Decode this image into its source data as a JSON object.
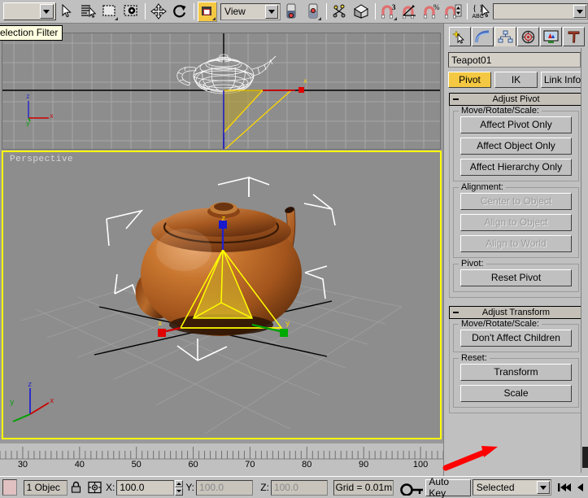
{
  "app": {
    "title": "3ds Max - Hierarchy / Pivot",
    "accent_yellow": "#f4c842",
    "viewport_bg": "#8d8d8d",
    "panel_bg": "#c0c0c0",
    "teapot_color": "#b35a19",
    "annotation_color": "#ff0000"
  },
  "tooltip": {
    "text": "election Filter"
  },
  "toolbar": {
    "selection_filter": {
      "value": "",
      "name": "selection-filter-combo"
    },
    "buttons": [
      {
        "name": "select-object-button",
        "icon": "arrow-cursor-icon",
        "label": "Select Object",
        "active": false
      },
      {
        "name": "select-by-name-button",
        "icon": "list-cursor-icon",
        "label": "Select by Name",
        "active": false
      },
      {
        "name": "rectangular-selection-region-button",
        "icon": "rect-marquee-icon",
        "label": "Rectangular Selection Region",
        "active": false
      },
      {
        "name": "window-crossing-button",
        "icon": "window-crossing-icon",
        "label": "Window / Crossing",
        "active": false
      },
      {
        "name": "select-and-move-button",
        "icon": "move-cross-icon",
        "label": "Select and Move",
        "active": false
      },
      {
        "name": "select-and-rotate-button",
        "icon": "rotate-arrow-icon",
        "label": "Select and Rotate",
        "active": false
      },
      {
        "name": "select-and-uniform-scale-button",
        "icon": "scale-box-icon",
        "label": "Select and Uniform Scale",
        "active": true
      }
    ],
    "reference_coordinate_system": {
      "value": "View",
      "name": "reference-coordinate-system-combo"
    },
    "pivot_buttons": [
      {
        "name": "use-pivot-point-center-button",
        "icon": "pivot-center-icon",
        "label": "Use Pivot Point Center"
      },
      {
        "name": "use-selection-center-button",
        "icon": "selection-center-icon",
        "label": "Use Selection Center"
      }
    ],
    "right_buttons": [
      {
        "name": "select-and-link-button",
        "icon": "link-chain-icon",
        "label": "Select and Link"
      },
      {
        "name": "mirror-button",
        "icon": "mirror-box-icon",
        "label": "Mirror"
      },
      {
        "name": "snaps-toggle-button",
        "icon": "magnet-3-icon",
        "label": "Snaps Toggle",
        "badge": "3"
      },
      {
        "name": "angle-snap-toggle-button",
        "icon": "magnet-angle-icon",
        "label": "Angle Snap Toggle"
      },
      {
        "name": "percent-snap-toggle-button",
        "icon": "magnet-percent-icon",
        "label": "Percent Snap Toggle",
        "badge": "%"
      },
      {
        "name": "spinner-snap-toggle-button",
        "icon": "magnet-spinner-icon",
        "label": "Spinner Snap Toggle"
      },
      {
        "name": "named-selection-sets-button",
        "icon": "named-selection-icon",
        "label": "Named Selection Sets"
      }
    ],
    "named_selection_field": {
      "value": "",
      "name": "named-selection-field"
    }
  },
  "viewports": [
    {
      "name": "viewport-front",
      "label": "",
      "active": false,
      "shading": "wireframe",
      "object": "teapot-wireframe"
    },
    {
      "name": "viewport-perspective",
      "label": "Perspective",
      "active": true,
      "shading": "smooth-highlights",
      "object": "teapot-shaded"
    }
  ],
  "axis_tripod": {
    "x": "x",
    "y": "y",
    "z": "z",
    "x_color": "#cc0000",
    "y_color": "#00a000",
    "z_color": "#2222cc"
  },
  "command_panel": {
    "tabs": [
      {
        "name": "tab-create",
        "icon": "star-arrow-icon",
        "label": "Create",
        "selected": false
      },
      {
        "name": "tab-modify",
        "icon": "curve-bend-icon",
        "label": "Modify",
        "selected": false
      },
      {
        "name": "tab-hierarchy",
        "icon": "hierarchy-tree-icon",
        "label": "Hierarchy",
        "selected": true
      },
      {
        "name": "tab-motion",
        "icon": "motion-wheel-icon",
        "label": "Motion",
        "selected": false
      },
      {
        "name": "tab-display",
        "icon": "display-monitor-icon",
        "label": "Display",
        "selected": false
      },
      {
        "name": "tab-utilities",
        "icon": "hammer-icon",
        "label": "Utilities",
        "selected": false
      }
    ],
    "object_name": {
      "value": "Teapot01",
      "placeholder": ""
    },
    "object_color": "#b8561a",
    "mode_buttons": [
      {
        "name": "pivot-mode-button",
        "label": "Pivot",
        "active": true
      },
      {
        "name": "ik-mode-button",
        "label": "IK",
        "active": false
      },
      {
        "name": "link-info-mode-button",
        "label": "Link Info",
        "active": false
      }
    ],
    "rollouts": [
      {
        "name": "rollout-adjust-pivot",
        "title": "Adjust Pivot",
        "expanded": true,
        "groups": [
          {
            "name": "group-move-rotate-scale",
            "label": "Move/Rotate/Scale:",
            "buttons": [
              {
                "name": "affect-pivot-only-button",
                "label": "Affect Pivot Only",
                "disabled": false
              },
              {
                "name": "affect-object-only-button",
                "label": "Affect Object Only",
                "disabled": false
              },
              {
                "name": "affect-hierarchy-only-button",
                "label": "Affect Hierarchy Only",
                "disabled": false
              }
            ]
          },
          {
            "name": "group-alignment",
            "label": "Alignment:",
            "buttons": [
              {
                "name": "center-to-object-button",
                "label": "Center to Object",
                "disabled": true
              },
              {
                "name": "align-to-object-button",
                "label": "Align to Object",
                "disabled": true
              },
              {
                "name": "align-to-world-button",
                "label": "Align to World",
                "disabled": true
              }
            ]
          },
          {
            "name": "group-pivot",
            "label": "Pivot:",
            "buttons": [
              {
                "name": "reset-pivot-button",
                "label": "Reset Pivot",
                "disabled": false
              }
            ]
          }
        ]
      },
      {
        "name": "rollout-adjust-transform",
        "title": "Adjust Transform",
        "expanded": true,
        "groups": [
          {
            "name": "group-transform-move-rotate-scale",
            "label": "Move/Rotate/Scale:",
            "buttons": [
              {
                "name": "dont-affect-children-button",
                "label": "Don't Affect Children",
                "disabled": false
              }
            ]
          },
          {
            "name": "group-reset",
            "label": "Reset:",
            "buttons": [
              {
                "name": "reset-transform-button",
                "label": "Transform",
                "disabled": false
              },
              {
                "name": "reset-scale-button",
                "label": "Scale",
                "disabled": false
              }
            ]
          }
        ]
      }
    ]
  },
  "timeline": {
    "ticks": [
      30,
      40,
      50,
      60,
      70,
      80,
      90,
      100
    ],
    "min": 26,
    "max": 104
  },
  "statusbar": {
    "object_count": "1 Objec",
    "lock_icon": "lock-icon",
    "coordinate_icon": "absolute-relative-icon",
    "fields": [
      {
        "name": "x-coordinate-field",
        "label": "X:",
        "value": "100.0",
        "disabled": false
      },
      {
        "name": "y-coordinate-field",
        "label": "Y:",
        "value": "100.0",
        "disabled": true
      },
      {
        "name": "z-coordinate-field",
        "label": "Z:",
        "value": "100.0",
        "disabled": true
      }
    ],
    "grid_text": "Grid = 0.01m",
    "key_mode_icon": "key-icon",
    "auto_key_label": "Auto Key",
    "key_filter": {
      "value": "Selected"
    },
    "nav_buttons": [
      {
        "name": "go-to-start-button",
        "icon": "skip-to-start-icon"
      },
      {
        "name": "previous-frame-button",
        "icon": "step-back-icon"
      }
    ]
  }
}
